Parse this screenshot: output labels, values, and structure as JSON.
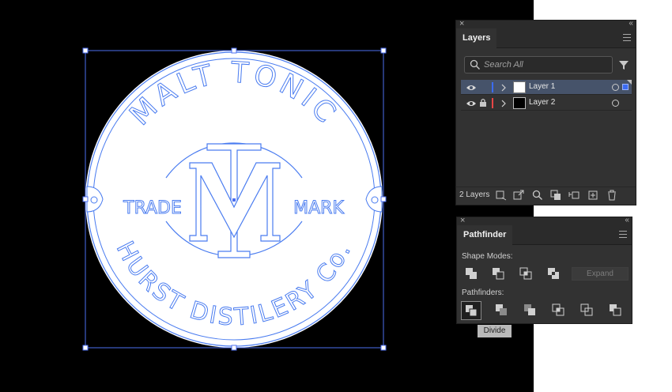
{
  "artwork": {
    "top_arc_text": "MALT TONIC",
    "bottom_arc_text": "HURST DISTILERY Co.",
    "left_text": "TRADE",
    "right_text": "MARK",
    "monogram": "TM",
    "outline_color": "#4a7cf0"
  },
  "layers_panel": {
    "title": "Layers",
    "search_placeholder": "Search All",
    "layers": [
      {
        "name": "Layer 1",
        "color": "#3b6cf5",
        "selected": true,
        "locked": false
      },
      {
        "name": "Layer 2",
        "color": "#e84646",
        "selected": false,
        "locked": true
      }
    ],
    "count_label": "2 Layers"
  },
  "pathfinder_panel": {
    "title": "Pathfinder",
    "shape_modes_label": "Shape Modes:",
    "expand_label": "Expand",
    "pathfinders_label": "Pathfinders:",
    "tooltip": "Divide"
  }
}
